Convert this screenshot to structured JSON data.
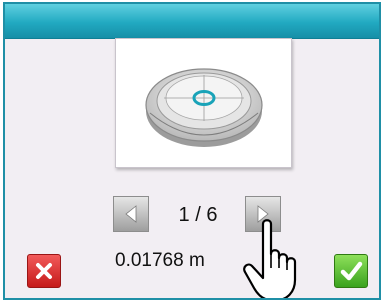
{
  "viewer": {
    "page_indicator": "1 / 6",
    "value_text": "0.01768 m"
  },
  "icons": {
    "preview": "level-gauge-icon",
    "prev": "chevron-left-icon",
    "next": "chevron-right-icon",
    "cancel": "close-icon",
    "confirm": "checkmark-icon",
    "pointer": "hand-pointer-icon"
  },
  "colors": {
    "titlebar": "#21a9c1",
    "cancel": "#d22a2a",
    "confirm": "#47ad22",
    "bubble": "#19a3b8"
  }
}
